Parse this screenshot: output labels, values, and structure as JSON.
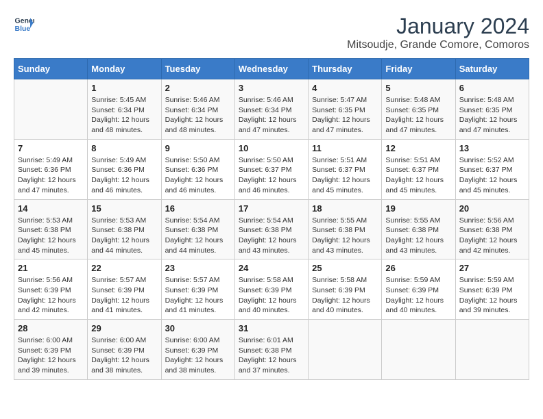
{
  "header": {
    "logo_line1": "General",
    "logo_line2": "Blue",
    "month_year": "January 2024",
    "location": "Mitsoudje, Grande Comore, Comoros"
  },
  "days_of_week": [
    "Sunday",
    "Monday",
    "Tuesday",
    "Wednesday",
    "Thursday",
    "Friday",
    "Saturday"
  ],
  "weeks": [
    [
      {
        "day": "",
        "sunrise": "",
        "sunset": "",
        "daylight": ""
      },
      {
        "day": "1",
        "sunrise": "5:45 AM",
        "sunset": "6:34 PM",
        "daylight": "12 hours and 48 minutes."
      },
      {
        "day": "2",
        "sunrise": "5:46 AM",
        "sunset": "6:34 PM",
        "daylight": "12 hours and 48 minutes."
      },
      {
        "day": "3",
        "sunrise": "5:46 AM",
        "sunset": "6:34 PM",
        "daylight": "12 hours and 47 minutes."
      },
      {
        "day": "4",
        "sunrise": "5:47 AM",
        "sunset": "6:35 PM",
        "daylight": "12 hours and 47 minutes."
      },
      {
        "day": "5",
        "sunrise": "5:48 AM",
        "sunset": "6:35 PM",
        "daylight": "12 hours and 47 minutes."
      },
      {
        "day": "6",
        "sunrise": "5:48 AM",
        "sunset": "6:35 PM",
        "daylight": "12 hours and 47 minutes."
      }
    ],
    [
      {
        "day": "7",
        "sunrise": "5:49 AM",
        "sunset": "6:36 PM",
        "daylight": "12 hours and 47 minutes."
      },
      {
        "day": "8",
        "sunrise": "5:49 AM",
        "sunset": "6:36 PM",
        "daylight": "12 hours and 46 minutes."
      },
      {
        "day": "9",
        "sunrise": "5:50 AM",
        "sunset": "6:36 PM",
        "daylight": "12 hours and 46 minutes."
      },
      {
        "day": "10",
        "sunrise": "5:50 AM",
        "sunset": "6:37 PM",
        "daylight": "12 hours and 46 minutes."
      },
      {
        "day": "11",
        "sunrise": "5:51 AM",
        "sunset": "6:37 PM",
        "daylight": "12 hours and 45 minutes."
      },
      {
        "day": "12",
        "sunrise": "5:51 AM",
        "sunset": "6:37 PM",
        "daylight": "12 hours and 45 minutes."
      },
      {
        "day": "13",
        "sunrise": "5:52 AM",
        "sunset": "6:37 PM",
        "daylight": "12 hours and 45 minutes."
      }
    ],
    [
      {
        "day": "14",
        "sunrise": "5:53 AM",
        "sunset": "6:38 PM",
        "daylight": "12 hours and 45 minutes."
      },
      {
        "day": "15",
        "sunrise": "5:53 AM",
        "sunset": "6:38 PM",
        "daylight": "12 hours and 44 minutes."
      },
      {
        "day": "16",
        "sunrise": "5:54 AM",
        "sunset": "6:38 PM",
        "daylight": "12 hours and 44 minutes."
      },
      {
        "day": "17",
        "sunrise": "5:54 AM",
        "sunset": "6:38 PM",
        "daylight": "12 hours and 43 minutes."
      },
      {
        "day": "18",
        "sunrise": "5:55 AM",
        "sunset": "6:38 PM",
        "daylight": "12 hours and 43 minutes."
      },
      {
        "day": "19",
        "sunrise": "5:55 AM",
        "sunset": "6:38 PM",
        "daylight": "12 hours and 43 minutes."
      },
      {
        "day": "20",
        "sunrise": "5:56 AM",
        "sunset": "6:38 PM",
        "daylight": "12 hours and 42 minutes."
      }
    ],
    [
      {
        "day": "21",
        "sunrise": "5:56 AM",
        "sunset": "6:39 PM",
        "daylight": "12 hours and 42 minutes."
      },
      {
        "day": "22",
        "sunrise": "5:57 AM",
        "sunset": "6:39 PM",
        "daylight": "12 hours and 41 minutes."
      },
      {
        "day": "23",
        "sunrise": "5:57 AM",
        "sunset": "6:39 PM",
        "daylight": "12 hours and 41 minutes."
      },
      {
        "day": "24",
        "sunrise": "5:58 AM",
        "sunset": "6:39 PM",
        "daylight": "12 hours and 40 minutes."
      },
      {
        "day": "25",
        "sunrise": "5:58 AM",
        "sunset": "6:39 PM",
        "daylight": "12 hours and 40 minutes."
      },
      {
        "day": "26",
        "sunrise": "5:59 AM",
        "sunset": "6:39 PM",
        "daylight": "12 hours and 40 minutes."
      },
      {
        "day": "27",
        "sunrise": "5:59 AM",
        "sunset": "6:39 PM",
        "daylight": "12 hours and 39 minutes."
      }
    ],
    [
      {
        "day": "28",
        "sunrise": "6:00 AM",
        "sunset": "6:39 PM",
        "daylight": "12 hours and 39 minutes."
      },
      {
        "day": "29",
        "sunrise": "6:00 AM",
        "sunset": "6:39 PM",
        "daylight": "12 hours and 38 minutes."
      },
      {
        "day": "30",
        "sunrise": "6:00 AM",
        "sunset": "6:39 PM",
        "daylight": "12 hours and 38 minutes."
      },
      {
        "day": "31",
        "sunrise": "6:01 AM",
        "sunset": "6:38 PM",
        "daylight": "12 hours and 37 minutes."
      },
      {
        "day": "",
        "sunrise": "",
        "sunset": "",
        "daylight": ""
      },
      {
        "day": "",
        "sunrise": "",
        "sunset": "",
        "daylight": ""
      },
      {
        "day": "",
        "sunrise": "",
        "sunset": "",
        "daylight": ""
      }
    ]
  ]
}
